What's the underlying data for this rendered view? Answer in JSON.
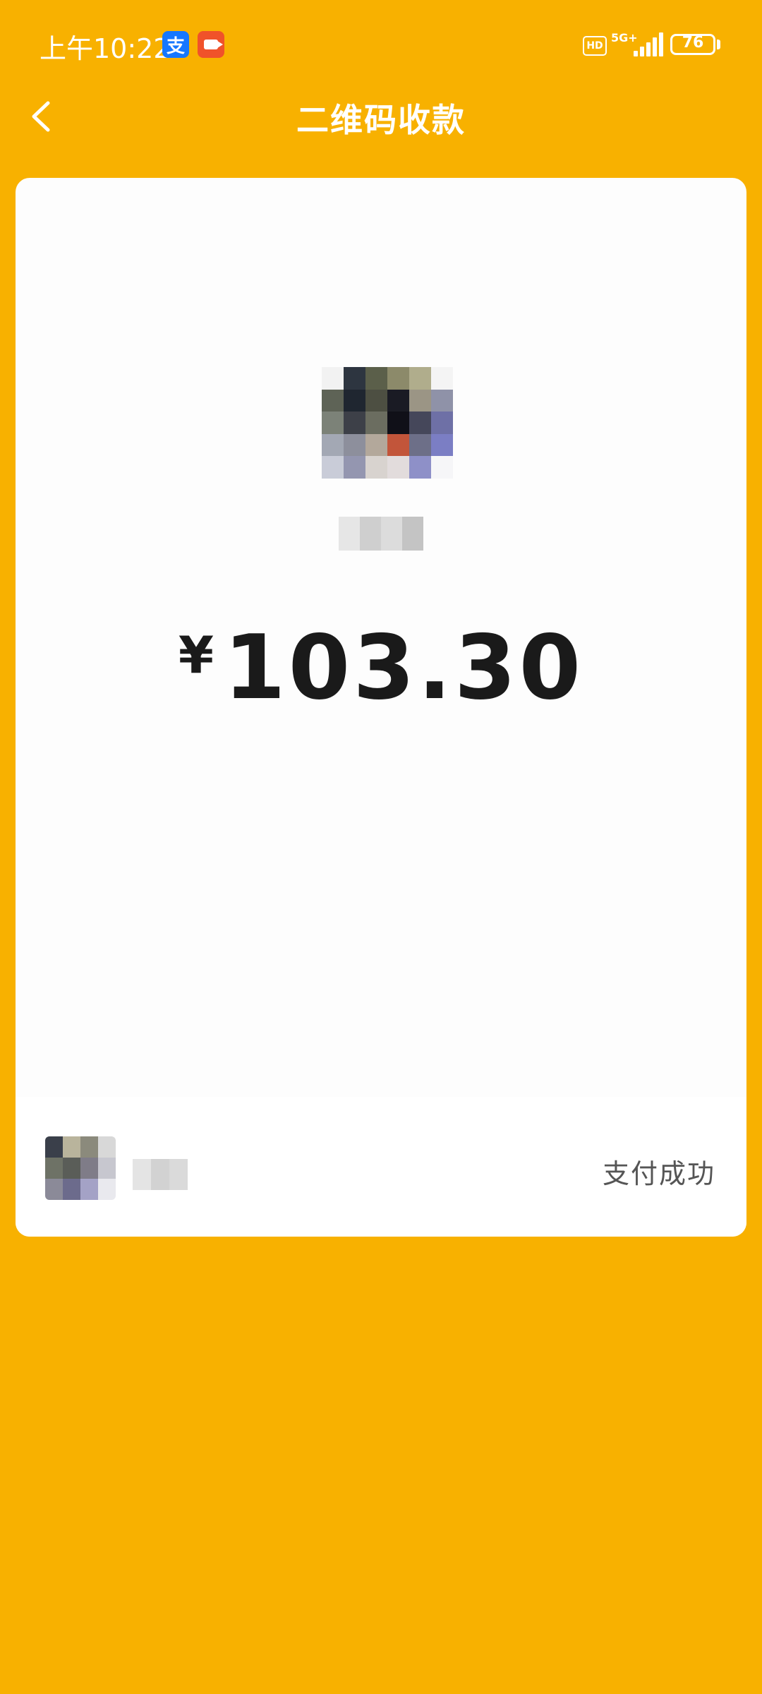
{
  "status_bar": {
    "time": "上午10:22",
    "alipay_badge": "支",
    "hd_badge": "HD",
    "network": "5G+",
    "battery": "76"
  },
  "nav": {
    "title": "二维码收款"
  },
  "payment": {
    "currency": "¥",
    "amount": "103.30",
    "status": "支付成功"
  },
  "icons": {
    "back": "chevron-left-icon",
    "alipay": "alipay-icon",
    "record": "video-record-icon",
    "signal": "signal-icon",
    "battery": "battery-icon"
  },
  "colors": {
    "background": "#F8B100",
    "card": "#FDFDFD",
    "amount_text": "#1A1A1A",
    "status_text": "#555555"
  }
}
